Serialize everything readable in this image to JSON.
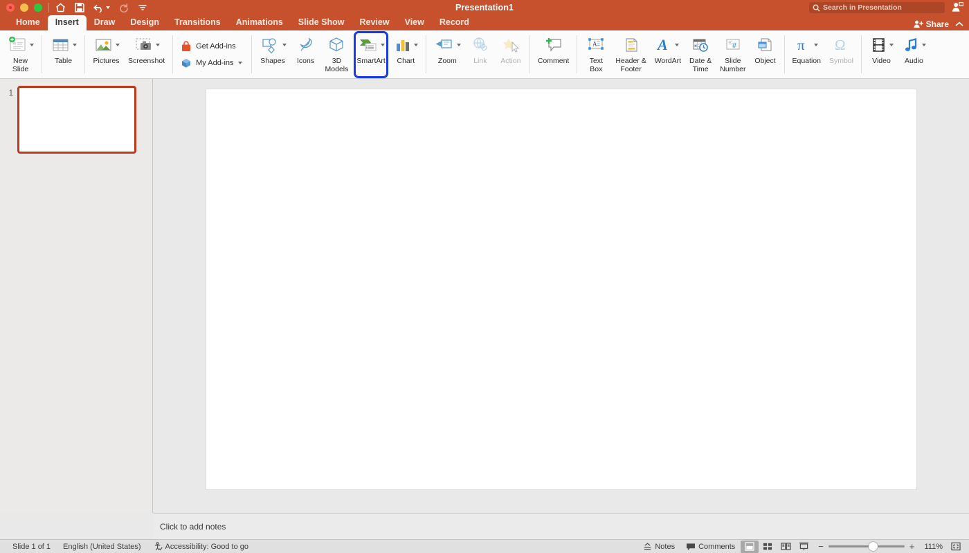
{
  "window": {
    "title": "Presentation1",
    "traffic_lights": [
      "close",
      "minimize",
      "maximize"
    ],
    "quick_access": [
      {
        "name": "home-icon",
        "label": "Home",
        "disabled": false
      },
      {
        "name": "save-icon",
        "label": "Save",
        "disabled": false
      },
      {
        "name": "undo-icon",
        "label": "Undo",
        "disabled": false,
        "has_caret": true
      },
      {
        "name": "redo-icon",
        "label": "Redo",
        "disabled": true
      },
      {
        "name": "customize-toolbar-icon",
        "label": "Customize Quick Access Toolbar",
        "disabled": false
      }
    ]
  },
  "search": {
    "placeholder": "Search in Presentation",
    "value": "",
    "icon": "search-icon"
  },
  "account": {
    "icon": "account-person-icon"
  },
  "share": {
    "label": "Share",
    "icon": "share-person-plus-icon",
    "collapse_icon": "chevron-up-icon"
  },
  "tabs": [
    {
      "label": "Home",
      "active": false
    },
    {
      "label": "Insert",
      "active": true
    },
    {
      "label": "Draw",
      "active": false
    },
    {
      "label": "Design",
      "active": false
    },
    {
      "label": "Transitions",
      "active": false
    },
    {
      "label": "Animations",
      "active": false
    },
    {
      "label": "Slide Show",
      "active": false
    },
    {
      "label": "Review",
      "active": false
    },
    {
      "label": "View",
      "active": false
    },
    {
      "label": "Record",
      "active": false
    }
  ],
  "ribbon": {
    "groups": [
      {
        "items": [
          {
            "label": "New\nSlide",
            "icon": "new-slide-icon",
            "caret": true,
            "disabled": false,
            "highlighted": false
          }
        ]
      },
      {
        "items": [
          {
            "label": "Table",
            "icon": "table-icon",
            "caret": true,
            "disabled": false,
            "highlighted": false
          }
        ]
      },
      {
        "items": [
          {
            "label": "Pictures",
            "icon": "pictures-icon",
            "caret": true,
            "disabled": false,
            "highlighted": false
          },
          {
            "label": "Screenshot",
            "icon": "screenshot-icon",
            "caret": true,
            "disabled": false,
            "highlighted": false
          }
        ]
      },
      {
        "stacked": [
          {
            "label": "Get Add-ins",
            "icon": "get-addins-icon",
            "caret": false
          },
          {
            "label": "My Add-ins",
            "icon": "my-addins-icon",
            "caret": true
          }
        ]
      },
      {
        "items": [
          {
            "label": "Shapes",
            "icon": "shapes-icon",
            "caret": true,
            "disabled": false,
            "highlighted": false
          },
          {
            "label": "Icons",
            "icon": "icons-icon",
            "caret": false,
            "disabled": false,
            "highlighted": false
          },
          {
            "label": "3D\nModels",
            "icon": "3d-models-icon",
            "caret": true,
            "disabled": false,
            "highlighted": false
          },
          {
            "label": "SmartArt",
            "icon": "smartart-icon",
            "caret": true,
            "disabled": false,
            "highlighted": true
          },
          {
            "label": "Chart",
            "icon": "chart-icon",
            "caret": true,
            "disabled": false,
            "highlighted": false
          }
        ]
      },
      {
        "items": [
          {
            "label": "Zoom",
            "icon": "zoom-icon",
            "caret": true,
            "disabled": false,
            "highlighted": false
          },
          {
            "label": "Link",
            "icon": "link-icon",
            "caret": false,
            "disabled": true,
            "highlighted": false
          },
          {
            "label": "Action",
            "icon": "action-icon",
            "caret": false,
            "disabled": true,
            "highlighted": false
          }
        ]
      },
      {
        "items": [
          {
            "label": "Comment",
            "icon": "comment-icon",
            "caret": false,
            "disabled": false,
            "highlighted": false
          }
        ]
      },
      {
        "items": [
          {
            "label": "Text\nBox",
            "icon": "text-box-icon",
            "caret": false,
            "disabled": false,
            "highlighted": false
          },
          {
            "label": "Header &\nFooter",
            "icon": "header-footer-icon",
            "caret": false,
            "disabled": false,
            "highlighted": false
          },
          {
            "label": "WordArt",
            "icon": "wordart-icon",
            "caret": true,
            "disabled": false,
            "highlighted": false
          },
          {
            "label": "Date &\nTime",
            "icon": "date-time-icon",
            "caret": false,
            "disabled": false,
            "highlighted": false
          },
          {
            "label": "Slide\nNumber",
            "icon": "slide-number-icon",
            "caret": false,
            "disabled": false,
            "highlighted": false
          },
          {
            "label": "Object",
            "icon": "object-icon",
            "caret": false,
            "disabled": false,
            "highlighted": false
          }
        ]
      },
      {
        "items": [
          {
            "label": "Equation",
            "icon": "equation-icon",
            "caret": true,
            "disabled": false,
            "highlighted": false
          },
          {
            "label": "Symbol",
            "icon": "symbol-icon",
            "caret": false,
            "disabled": true,
            "highlighted": false
          }
        ]
      },
      {
        "items": [
          {
            "label": "Video",
            "icon": "video-icon",
            "caret": true,
            "disabled": false,
            "highlighted": false
          },
          {
            "label": "Audio",
            "icon": "audio-icon",
            "caret": true,
            "disabled": false,
            "highlighted": false
          }
        ]
      }
    ]
  },
  "sidebar": {
    "slides": [
      {
        "number": "1",
        "selected": true
      }
    ]
  },
  "notes": {
    "placeholder": "Click to add notes"
  },
  "statusbar": {
    "slide_count": "Slide 1 of 1",
    "language": "English (United States)",
    "accessibility": "Accessibility: Good to go",
    "accessibility_icon": "accessibility-check-icon",
    "notes_label": "Notes",
    "notes_icon": "notes-icon",
    "comments_label": "Comments",
    "comments_icon": "comments-icon",
    "views": [
      {
        "name": "normal-view",
        "active": true
      },
      {
        "name": "slide-sorter-view",
        "active": false
      },
      {
        "name": "reading-view",
        "active": false
      },
      {
        "name": "slide-show-view",
        "active": false
      }
    ],
    "zoom_out_label": "−",
    "zoom_in_label": "+",
    "zoom_value": "111%",
    "fit_icon": "fit-to-window-icon"
  },
  "colors": {
    "brand_orange": "#c6512c",
    "highlight_blue": "#1a3ae8",
    "thumb_selected": "#c0391a",
    "ribbon_bg": "#fbfbfb",
    "canvas_bg": "#e9e9e9"
  }
}
